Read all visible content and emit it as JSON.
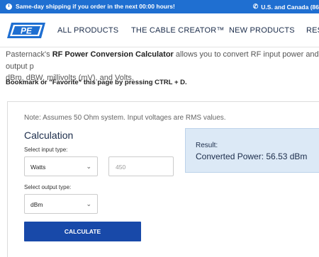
{
  "topbar": {
    "shipping_text": "Same-day shipping if you order in the next 00:00 hours!",
    "region_text": "U.S. and Canada (86"
  },
  "brand": {
    "logo_text": "PE",
    "accent_color": "#1f6fd1",
    "button_color": "#1849a9"
  },
  "nav": {
    "items": [
      "ALL PRODUCTS",
      "THE CABLE CREATOR™",
      "NEW PRODUCTS",
      "RES"
    ]
  },
  "intro": {
    "prefix": "Pasternack's ",
    "tool_name": "RF Power Conversion Calculator",
    "suffix": " allows you to convert RF input power and RF output p",
    "line2": "dBm, dBW, millivolts (mV), and Volts."
  },
  "bookmark_text": "Bookmark or \"Favorite\" this page by pressing CTRL + D.",
  "calculator": {
    "note": "Note: Assumes 50 Ohm system. Input voltages are RMS values.",
    "title": "Calculation",
    "input_type_label": "Select input type:",
    "input_type_value": "Watts",
    "input_value": "450",
    "output_type_label": "Select output type:",
    "output_type_value": "dBm",
    "button_label": "CALCULATE"
  },
  "result": {
    "label": "Result:",
    "text": "Converted Power:  56.53 dBm"
  }
}
